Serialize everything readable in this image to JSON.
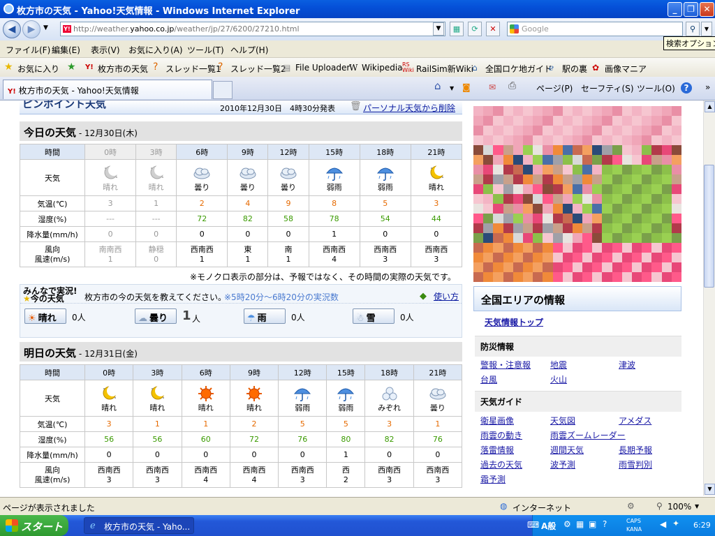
{
  "window": {
    "title": "枚方市の天気 - Yahoo!天気情報 - Windows Internet Explorer"
  },
  "nav": {
    "url_gray": "http://weather.",
    "url_dark": "yahoo.co.jp",
    "url_rest": "/weather/jp/27/6200/27210.html",
    "search_placeholder": "Google",
    "tooltip": "検索オプション"
  },
  "menu": [
    "ファイル(F)",
    "編集(E)",
    "表示(V)",
    "お気に入り(A)",
    "ツール(T)",
    "ヘルプ(H)"
  ],
  "favorites": {
    "label": "お気に入り",
    "items": [
      "枚方市の天気",
      "スレッド一覧1",
      "スレッド一覧2",
      "File Uploader",
      "Wikipedia",
      "RailSim新Wiki",
      "全国ロケ地ガイド",
      "駅の裏",
      "画像マニア"
    ]
  },
  "tab": {
    "label": "枚方市の天気 - Yahoo!天気情報"
  },
  "commands": [
    "ページ(P)",
    "セーフティ(S)",
    "ツール(O)"
  ],
  "pinpoint": {
    "title": "ピンポイント天気",
    "issued": "2010年12月30日　4時30分発表",
    "remove": "パーソナル天気から削除"
  },
  "today": {
    "heading": "今日の天気",
    "date": " - 12月30日(木)",
    "row_labels": [
      "時間",
      "天気",
      "気温(℃)",
      "湿度(%)",
      "降水量(mm/h)",
      "風向",
      "風速(m/s)"
    ],
    "times": [
      "0時",
      "3時",
      "6時",
      "9時",
      "12時",
      "15時",
      "18時",
      "21時"
    ],
    "weather": [
      "晴れ",
      "晴れ",
      "曇り",
      "曇り",
      "曇り",
      "弱雨",
      "弱雨",
      "晴れ"
    ],
    "icons": [
      "moon",
      "moon",
      "cloud",
      "cloud",
      "cloud",
      "umbrella",
      "umbrella",
      "moon"
    ],
    "temp": [
      "3",
      "1",
      "2",
      "4",
      "9",
      "8",
      "5",
      "3"
    ],
    "humidity": [
      "---",
      "---",
      "72",
      "82",
      "58",
      "78",
      "54",
      "44"
    ],
    "precip": [
      "0",
      "0",
      "0",
      "0",
      "0",
      "1",
      "0",
      "0"
    ],
    "wind_dir": [
      "南南西",
      "静穏",
      "西南西",
      "東",
      "南",
      "西南西",
      "西南西",
      "西南西"
    ],
    "wind_speed": [
      "1",
      "0",
      "1",
      "1",
      "1",
      "4",
      "3",
      "3"
    ],
    "note": "※モノクロ表示の部分は、予報ではなく、その時間の実際の天気です。"
  },
  "live": {
    "title1": "みんなで実況!",
    "title2": "今の天気",
    "prompt": "枚方市の今の天気を教えてください。",
    "window": "※5時20分～6時20分の実況数",
    "howto": "使い方",
    "buttons": [
      {
        "label": "晴れ",
        "count": "0人"
      },
      {
        "label": "曇り",
        "count": "1",
        "unit": "人"
      },
      {
        "label": "雨",
        "count": "0人"
      },
      {
        "label": "雪",
        "count": "0人"
      }
    ]
  },
  "tomorrow": {
    "heading": "明日の天気",
    "date": " - 12月31日(金)",
    "times": [
      "0時",
      "3時",
      "6時",
      "9時",
      "12時",
      "15時",
      "18時",
      "21時"
    ],
    "weather": [
      "晴れ",
      "晴れ",
      "晴れ",
      "晴れ",
      "弱雨",
      "弱雨",
      "みぞれ",
      "曇り"
    ],
    "icons": [
      "moon",
      "moon",
      "sun",
      "sun",
      "umbrella",
      "umbrella",
      "sleet",
      "cloud"
    ],
    "temp": [
      "3",
      "1",
      "1",
      "2",
      "5",
      "5",
      "3",
      "1"
    ],
    "humidity": [
      "56",
      "56",
      "60",
      "72",
      "76",
      "80",
      "82",
      "76"
    ],
    "precip": [
      "0",
      "0",
      "0",
      "0",
      "0",
      "1",
      "0",
      "0"
    ],
    "wind_dir": [
      "西南西",
      "西南西",
      "西南西",
      "西南西",
      "西南西",
      "西",
      "西南西",
      "西南西"
    ],
    "wind_speed": [
      "3",
      "3",
      "4",
      "4",
      "3",
      "2",
      "3",
      "3"
    ]
  },
  "sidebar": {
    "area_title": "全国エリアの情報",
    "top_link": "天気情報トップ",
    "disaster_title": "防災情報",
    "disaster_links": [
      "警報・注意報",
      "地震",
      "津波",
      "台風",
      "火山"
    ],
    "guide_title": "天気ガイド",
    "guide_links": [
      "衛星画像",
      "天気図",
      "アメダス",
      "雨雲の動き",
      "雨雲ズームレーダー",
      "落雷情報",
      "週間天気",
      "長期予報",
      "過去の天気",
      "波予測",
      "雨雪判別",
      "霜予測"
    ]
  },
  "status": {
    "text": "ページが表示されました",
    "zone": "インターネット",
    "zoom": "100%"
  },
  "taskbar": {
    "start": "スタート",
    "item": "枚方市の天気 - Yaho...",
    "ime": "A般",
    "caps": "CAPS",
    "kana": "KANA",
    "clock": "6:29"
  }
}
